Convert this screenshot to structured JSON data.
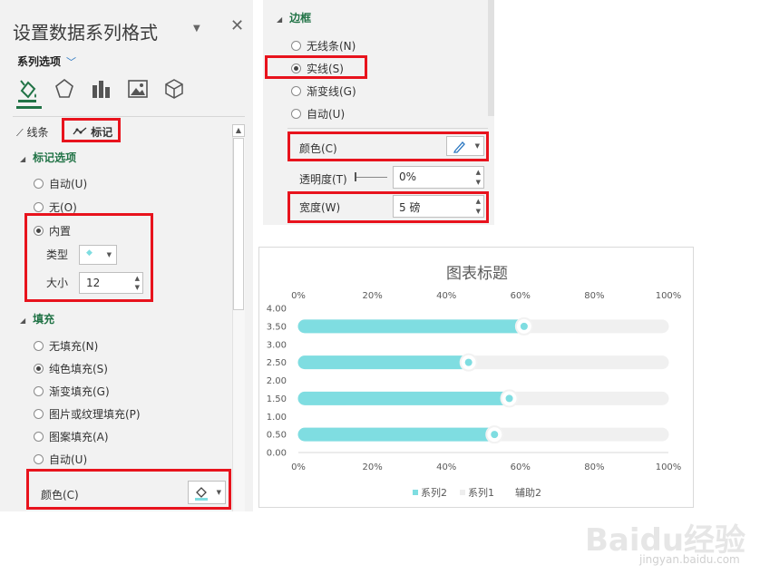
{
  "left_pane": {
    "title": "设置数据系列格式",
    "series_options_label": "系列选项",
    "tabs": [
      {
        "label": "线条",
        "icon": "line-icon"
      },
      {
        "label": "标记",
        "icon": "marker-line-icon"
      }
    ],
    "marker_options": {
      "header": "标记选项",
      "options": [
        "自动(U)",
        "无(O)",
        "内置"
      ],
      "selected": "内置",
      "type_label": "类型",
      "size_label": "大小",
      "size_value": "12"
    },
    "fill": {
      "header": "填充",
      "options": [
        "无填充(N)",
        "纯色填充(S)",
        "渐变填充(G)",
        "图片或纹理填充(P)",
        "图案填充(A)",
        "自动(U)"
      ],
      "selected": "纯色填充(S)",
      "color_label": "颜色(C)"
    }
  },
  "border_pane": {
    "header": "边框",
    "options": [
      "无线条(N)",
      "实线(S)",
      "渐变线(G)",
      "自动(U)"
    ],
    "selected": "实线(S)",
    "color_label": "颜色(C)",
    "transparency_label": "透明度(T)",
    "transparency_value": "0%",
    "width_label": "宽度(W)",
    "width_value": "5 磅"
  },
  "chart": {
    "title": "图表标题",
    "top_axis_ticks": [
      "0%",
      "20%",
      "40%",
      "60%",
      "80%",
      "100%"
    ],
    "bottom_axis_ticks": [
      "0%",
      "20%",
      "40%",
      "60%",
      "80%",
      "100%"
    ],
    "left_axis_ticks": [
      "4.00",
      "3.50",
      "3.00",
      "2.50",
      "2.00",
      "1.50",
      "1.00",
      "0.50",
      "0.00"
    ],
    "legend": [
      {
        "name": "系列2",
        "color": "#7fdde1"
      },
      {
        "name": "系列1",
        "color": "#f0f0f0"
      },
      {
        "name": "辅助2",
        "color": "#ffffff"
      }
    ]
  },
  "chart_data": {
    "type": "bar",
    "title": "图表标题",
    "orientation": "horizontal",
    "y_positions": [
      3.5,
      2.5,
      1.5,
      0.5
    ],
    "series": [
      {
        "name": "系列2",
        "values": [
          0.61,
          0.46,
          0.57,
          0.53
        ],
        "color": "#7fdde1"
      },
      {
        "name": "系列1",
        "values": [
          1,
          1,
          1,
          1
        ],
        "color": "#f0f0f0"
      }
    ],
    "xlim": [
      0,
      1
    ],
    "ylim": [
      0,
      4
    ],
    "legend_position": "bottom"
  },
  "colors": {
    "accent_green": "#217346",
    "highlight_red": "#e8131d",
    "bar_teal": "#7fdde1",
    "track_gray": "#f0f0f0"
  },
  "watermark": {
    "brand": "Baidu经验",
    "url": "jingyan.baidu.com"
  }
}
